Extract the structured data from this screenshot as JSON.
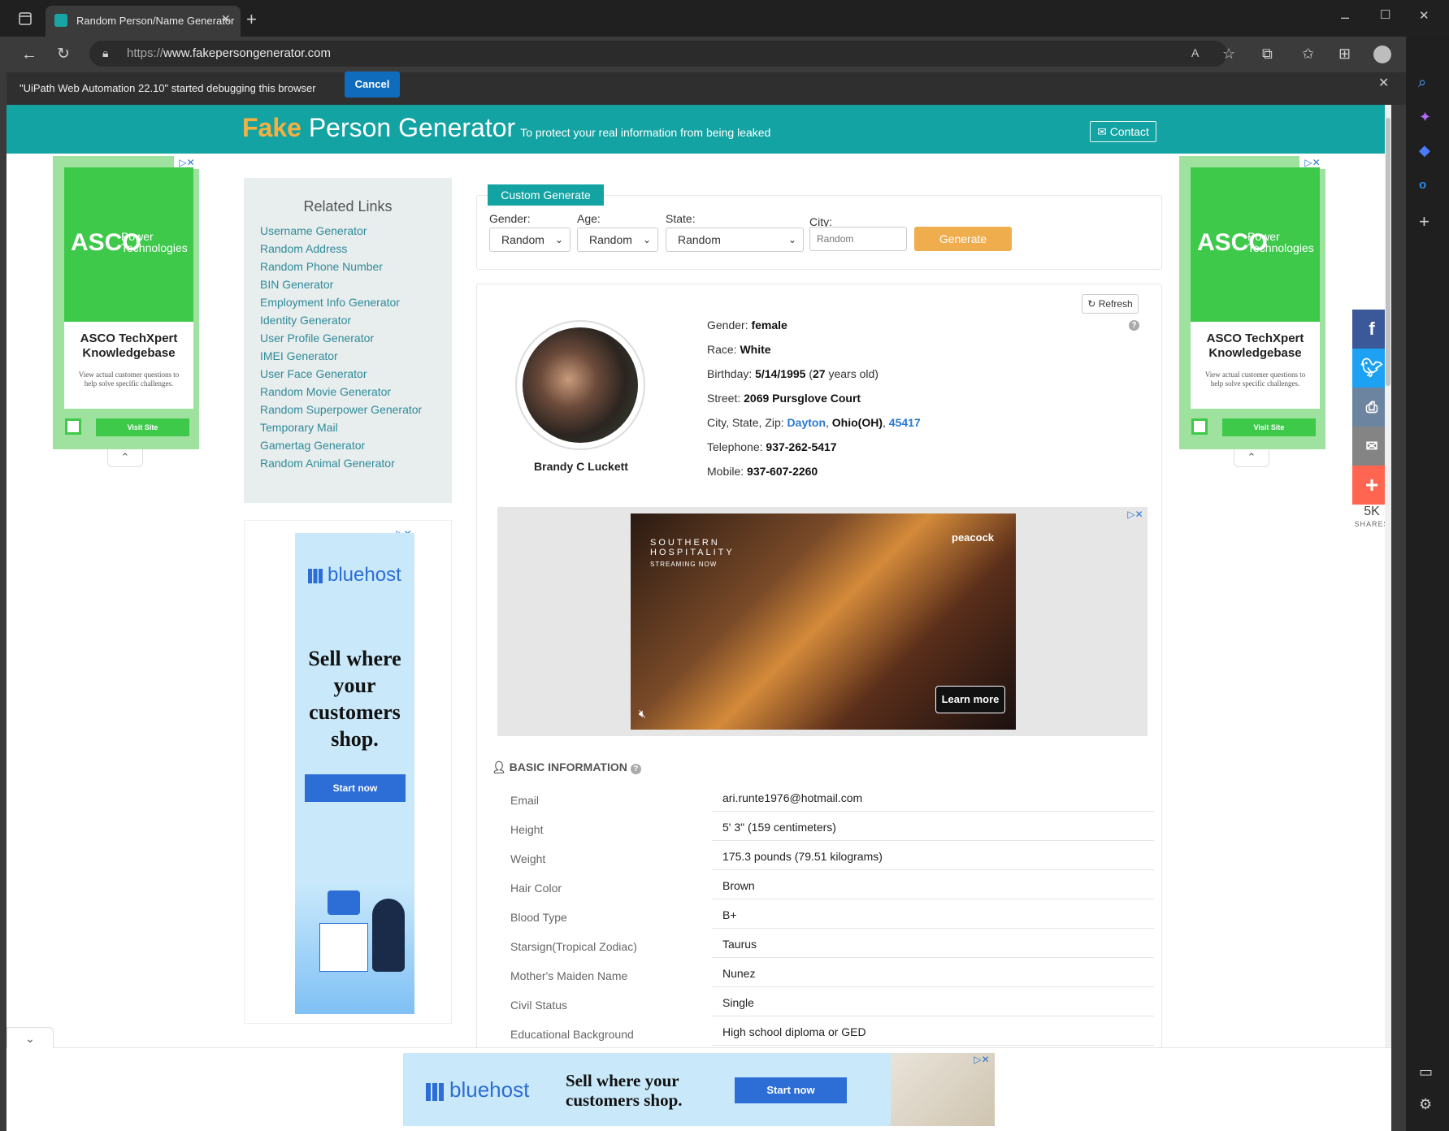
{
  "browser": {
    "tab_title": "Random Person/Name Generator",
    "url_scheme": "https://",
    "url_host": "www.fakepersongenerator.com",
    "debug_message": "\"UiPath Web Automation 22.10\" started debugging this browser",
    "cancel_label": "Cancel"
  },
  "header": {
    "brand_fake": "Fake",
    "brand_rest": " Person Generator",
    "tagline": "To protect your real information from being leaked",
    "contact_label": "Contact"
  },
  "ads": {
    "asco_brand": "ASCO",
    "asco_power": "Power",
    "asco_tech": "Technologies",
    "asco_title": "ASCO TechXpert Knowledgebase",
    "asco_body": "View actual customer questions to help solve specific challenges.",
    "asco_cta": "Visit Site",
    "bluehost_brand": "bluehost",
    "bluehost_headline": "Sell where your customers shop.",
    "bluehost_cta": "Start now",
    "video_show": "SOUTHERN HOSPITALITY",
    "video_sub": "STREAMING NOW",
    "video_network": "peacock",
    "video_cta": "Learn more"
  },
  "related": {
    "title": "Related Links",
    "links": [
      "Username Generator",
      "Random Address",
      "Random Phone Number",
      "BIN Generator",
      "Employment Info Generator",
      "Identity Generator",
      "User Profile Generator",
      "IMEI Generator",
      "User Face Generator",
      "Random Movie Generator",
      "Random Superpower Generator",
      "Temporary Mail",
      "Gamertag Generator",
      "Random Animal Generator"
    ]
  },
  "custom": {
    "title": "Custom Generate",
    "gender_label": "Gender:",
    "gender_value": "Random",
    "age_label": "Age:",
    "age_value": "Random",
    "state_label": "State:",
    "state_value": "Random",
    "city_label": "City:",
    "city_placeholder": "Random",
    "generate_label": "Generate"
  },
  "person": {
    "refresh_label": "Refresh",
    "name": "Brandy C Luckett",
    "gender_label": "Gender: ",
    "gender": "female",
    "race_label": "Race: ",
    "race": "White",
    "birthday_label": "Birthday: ",
    "birthday": "5/14/1995",
    "age": "27",
    "age_suffix": " years old)",
    "street_label": "Street: ",
    "street": "2069 Pursglove Court",
    "csz_label": "City, State, Zip: ",
    "city": "Dayton",
    "state": "Ohio(OH)",
    "zip": "45417",
    "telephone_label": "Telephone: ",
    "telephone": "937-262-5417",
    "mobile_label": "Mobile: ",
    "mobile": "937-607-2260"
  },
  "basic": {
    "title": "BASIC INFORMATION",
    "rows": [
      {
        "label": "Email",
        "value": "ari.runte1976@hotmail.com"
      },
      {
        "label": "Height",
        "value": "5' 3\" (159 centimeters)"
      },
      {
        "label": "Weight",
        "value": "175.3 pounds (79.51 kilograms)"
      },
      {
        "label": "Hair Color",
        "value": "Brown"
      },
      {
        "label": "Blood Type",
        "value": "B+"
      },
      {
        "label": "Starsign(Tropical Zodiac)",
        "value": "Taurus"
      },
      {
        "label": "Mother's Maiden Name",
        "value": "Nunez"
      },
      {
        "label": "Civil Status",
        "value": "Single"
      },
      {
        "label": "Educational Background",
        "value": "High school diploma or GED"
      }
    ]
  },
  "share": {
    "count": "5K",
    "label": "SHARES"
  },
  "colors": {
    "brand_teal": "#13a3a3",
    "accent_orange": "#f0ad4e",
    "link_blue": "#2a79d1"
  }
}
